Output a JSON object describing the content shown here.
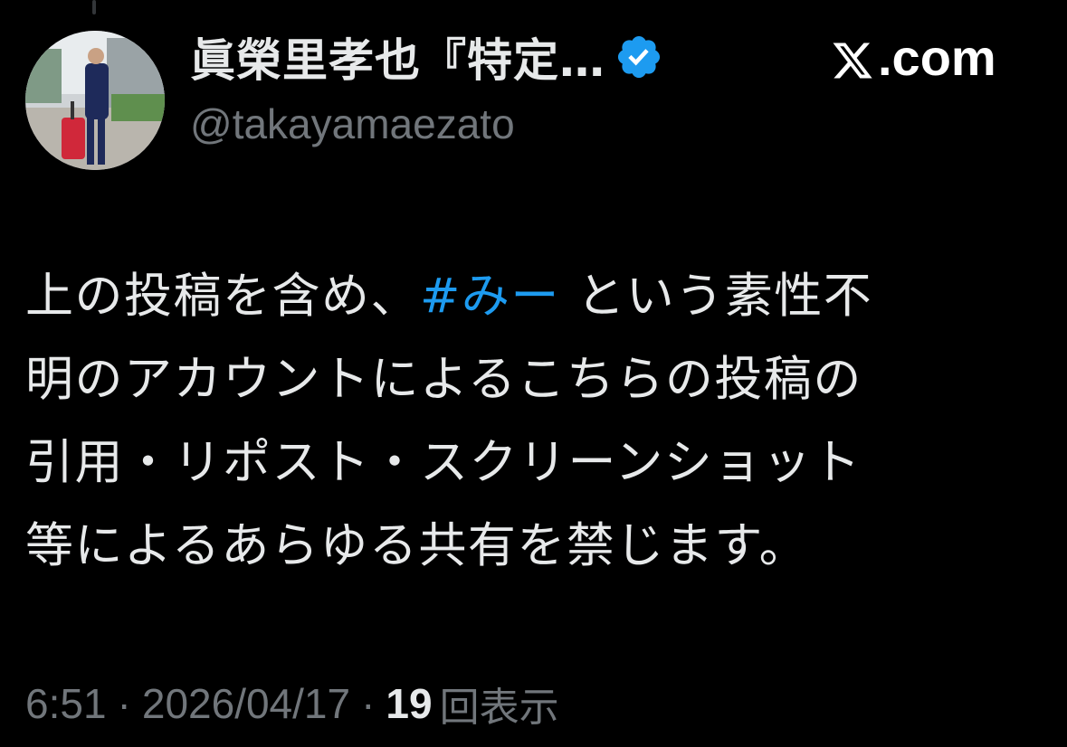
{
  "author": {
    "display_name": "眞榮里孝也『特定…",
    "handle": "@takayamaezato",
    "verified_icon": "verified-badge-icon",
    "avatar": "profile-photo"
  },
  "brand": {
    "icon": "x-logo-icon",
    "text": ".com"
  },
  "tweet": {
    "line1_before": "上の投稿を含め、",
    "hashtag": "#みー",
    "line1_after": " という素性不",
    "line2": "明のアカウントによるこちらの投稿の",
    "line3": "引用・リポスト・スクリーンショット",
    "line4": "等によるあらゆる共有を禁じます。"
  },
  "meta": {
    "time": "6:51",
    "separator": "·",
    "date": "2026/04/17",
    "view_count": "19",
    "views_label": "回表示"
  },
  "colors": {
    "background": "#000000",
    "text": "#e7e9ea",
    "secondary": "#71767b",
    "link": "#1d9bf0",
    "verified": "#1d9bf0"
  }
}
